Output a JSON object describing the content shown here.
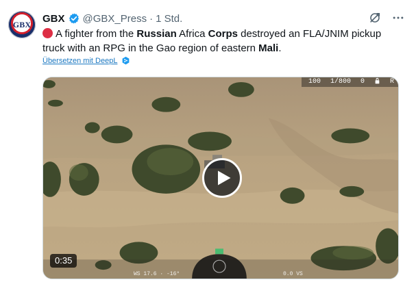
{
  "author": {
    "avatar_text": "GBX",
    "display_name": "GBX",
    "verified_icon": "verified-badge-icon",
    "handle": "@GBX_Press",
    "separator": "·",
    "time": "1 Std."
  },
  "actions": {
    "grok_icon": "grok-icon",
    "more_icon": "more-icon"
  },
  "tweet": {
    "emoji": "red-circle",
    "text_segments": [
      "A fighter from the ",
      "Russian",
      " Africa ",
      "Corps",
      " destroyed an FLA/JNIM pickup truck with an RPG in the Gao region of eastern ",
      "Mali",
      "."
    ]
  },
  "translate": {
    "label": "Übersetzen mit DeepL",
    "icon": "deepl-icon"
  },
  "media": {
    "hud_top": [
      "100",
      "1/800",
      "0",
      "",
      "R"
    ],
    "hud_bottom_left": "WS 17.6 · -16°",
    "hud_bottom_right": "0.0  VS",
    "duration": "0:35",
    "play_icon": "play-icon"
  },
  "colors": {
    "accent": "#1d9bf0",
    "text": "#0f1419",
    "secondary": "#536471",
    "emoji_red": "#dd2e44"
  }
}
